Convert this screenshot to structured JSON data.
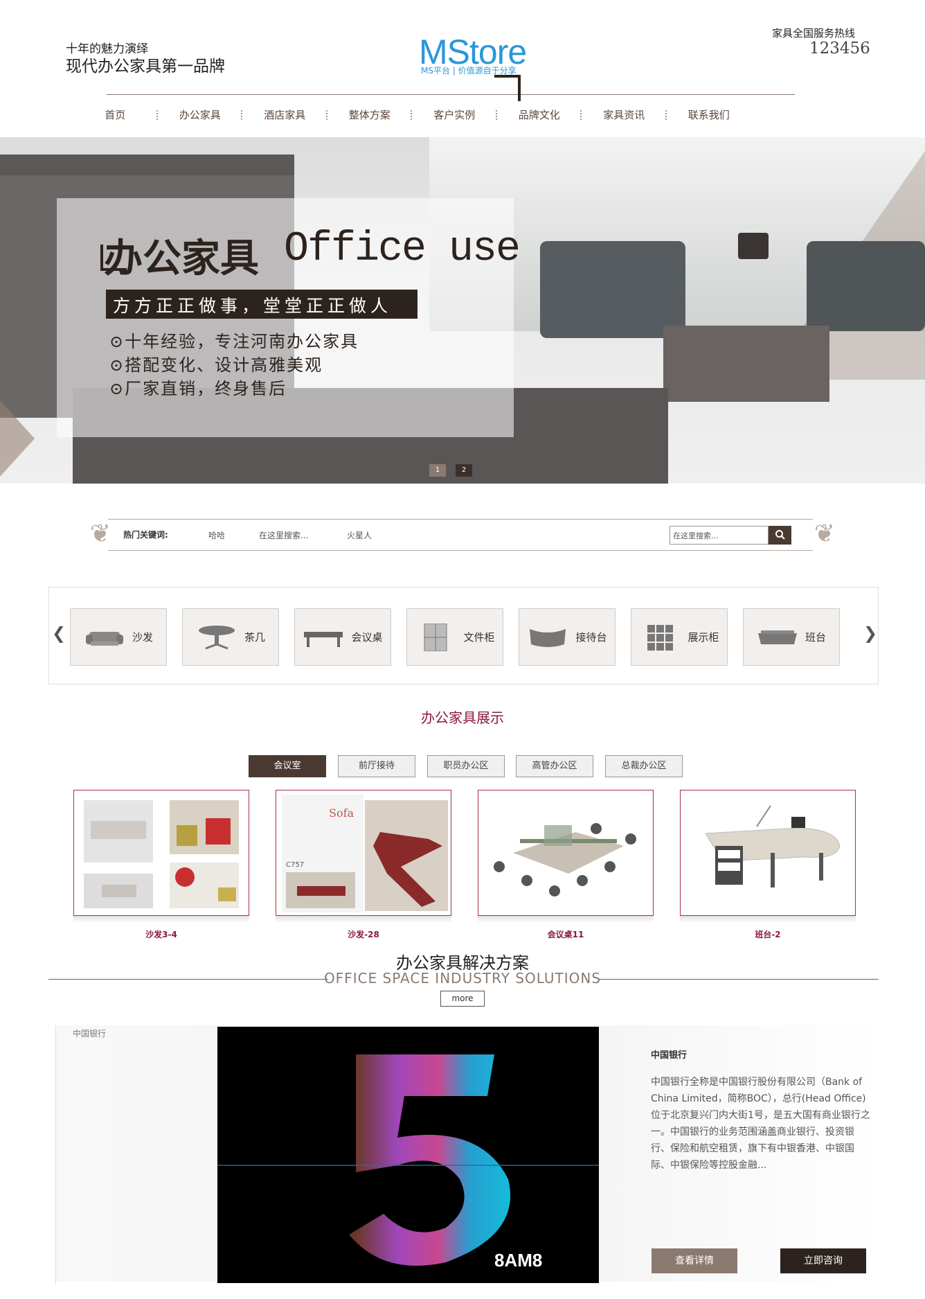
{
  "header": {
    "slogan_small": "十年的魅力演绎",
    "slogan_big": "现代办公家具第一品牌",
    "logo": "MStore",
    "logo_sub": "MS平台 | 价值源自于分享",
    "hotline_label": "家具全国服务热线",
    "hotline_number": "123456"
  },
  "nav": [
    "首页",
    "办公家具",
    "酒店家具",
    "整体方案",
    "客户实例",
    "品牌文化",
    "家具资讯",
    "联系我们"
  ],
  "banner": {
    "title_cn": "办公家具",
    "title_en": "Office use",
    "tagline": "方方正正做事，堂堂正正做人",
    "points": [
      "⊙十年经验，专注河南办公家具",
      "⊙搭配变化、设计高雅美观",
      "⊙厂家直销，终身售后"
    ],
    "dots": [
      "1",
      "2"
    ]
  },
  "search": {
    "hot_label": "热门关键词:",
    "keywords": [
      "哈哈",
      "在这里搜索...",
      "火星人"
    ],
    "placeholder": "在这里搜索...",
    "icon": "search-icon"
  },
  "categories": [
    {
      "label": "沙发",
      "icon": "sofa-icon"
    },
    {
      "label": "茶几",
      "icon": "tea-table-icon"
    },
    {
      "label": "会议桌",
      "icon": "conference-table-icon"
    },
    {
      "label": "文件柜",
      "icon": "file-cabinet-icon"
    },
    {
      "label": "接待台",
      "icon": "reception-desk-icon"
    },
    {
      "label": "展示柜",
      "icon": "display-cabinet-icon"
    },
    {
      "label": "班台",
      "icon": "office-desk-icon"
    }
  ],
  "showcase": {
    "title": "办公家具展示",
    "tabs": [
      "会议室",
      "前厅接待",
      "职员办公区",
      "高管办公区",
      "总裁办公区"
    ],
    "active_tab": 0,
    "products": [
      {
        "caption": "沙发3-4"
      },
      {
        "caption": "沙发-28"
      },
      {
        "caption": "会议桌11"
      },
      {
        "caption": "班台-2"
      }
    ],
    "product_brand_text": [
      "Sofa",
      "C757"
    ]
  },
  "solutions": {
    "title": "办公家具解决方案",
    "subtitle": "OFFICE SPACE INDUSTRY SOLUTIONS",
    "more": "more",
    "case_label": "中国银行",
    "case_title": "中国银行",
    "case_text": "中国银行全称是中国银行股份有限公司（Bank of China Limited，简称BOC），总行(Head Office)位于北京复兴门内大街1号，是五大国有商业银行之一。中国银行的业务范围涵盖商业银行、投资银行、保险和航空租赁，旗下有中银香港、中银国际、中银保险等控股金融...",
    "video_logo": "8AM8",
    "btn_detail": "查看详情",
    "btn_consult": "立即咨询"
  },
  "colors": {
    "brand_blue": "#2a96d8",
    "dark_brown": "#2d231e",
    "accent_red": "#8b1a3a",
    "taupe": "#8a7a70"
  }
}
